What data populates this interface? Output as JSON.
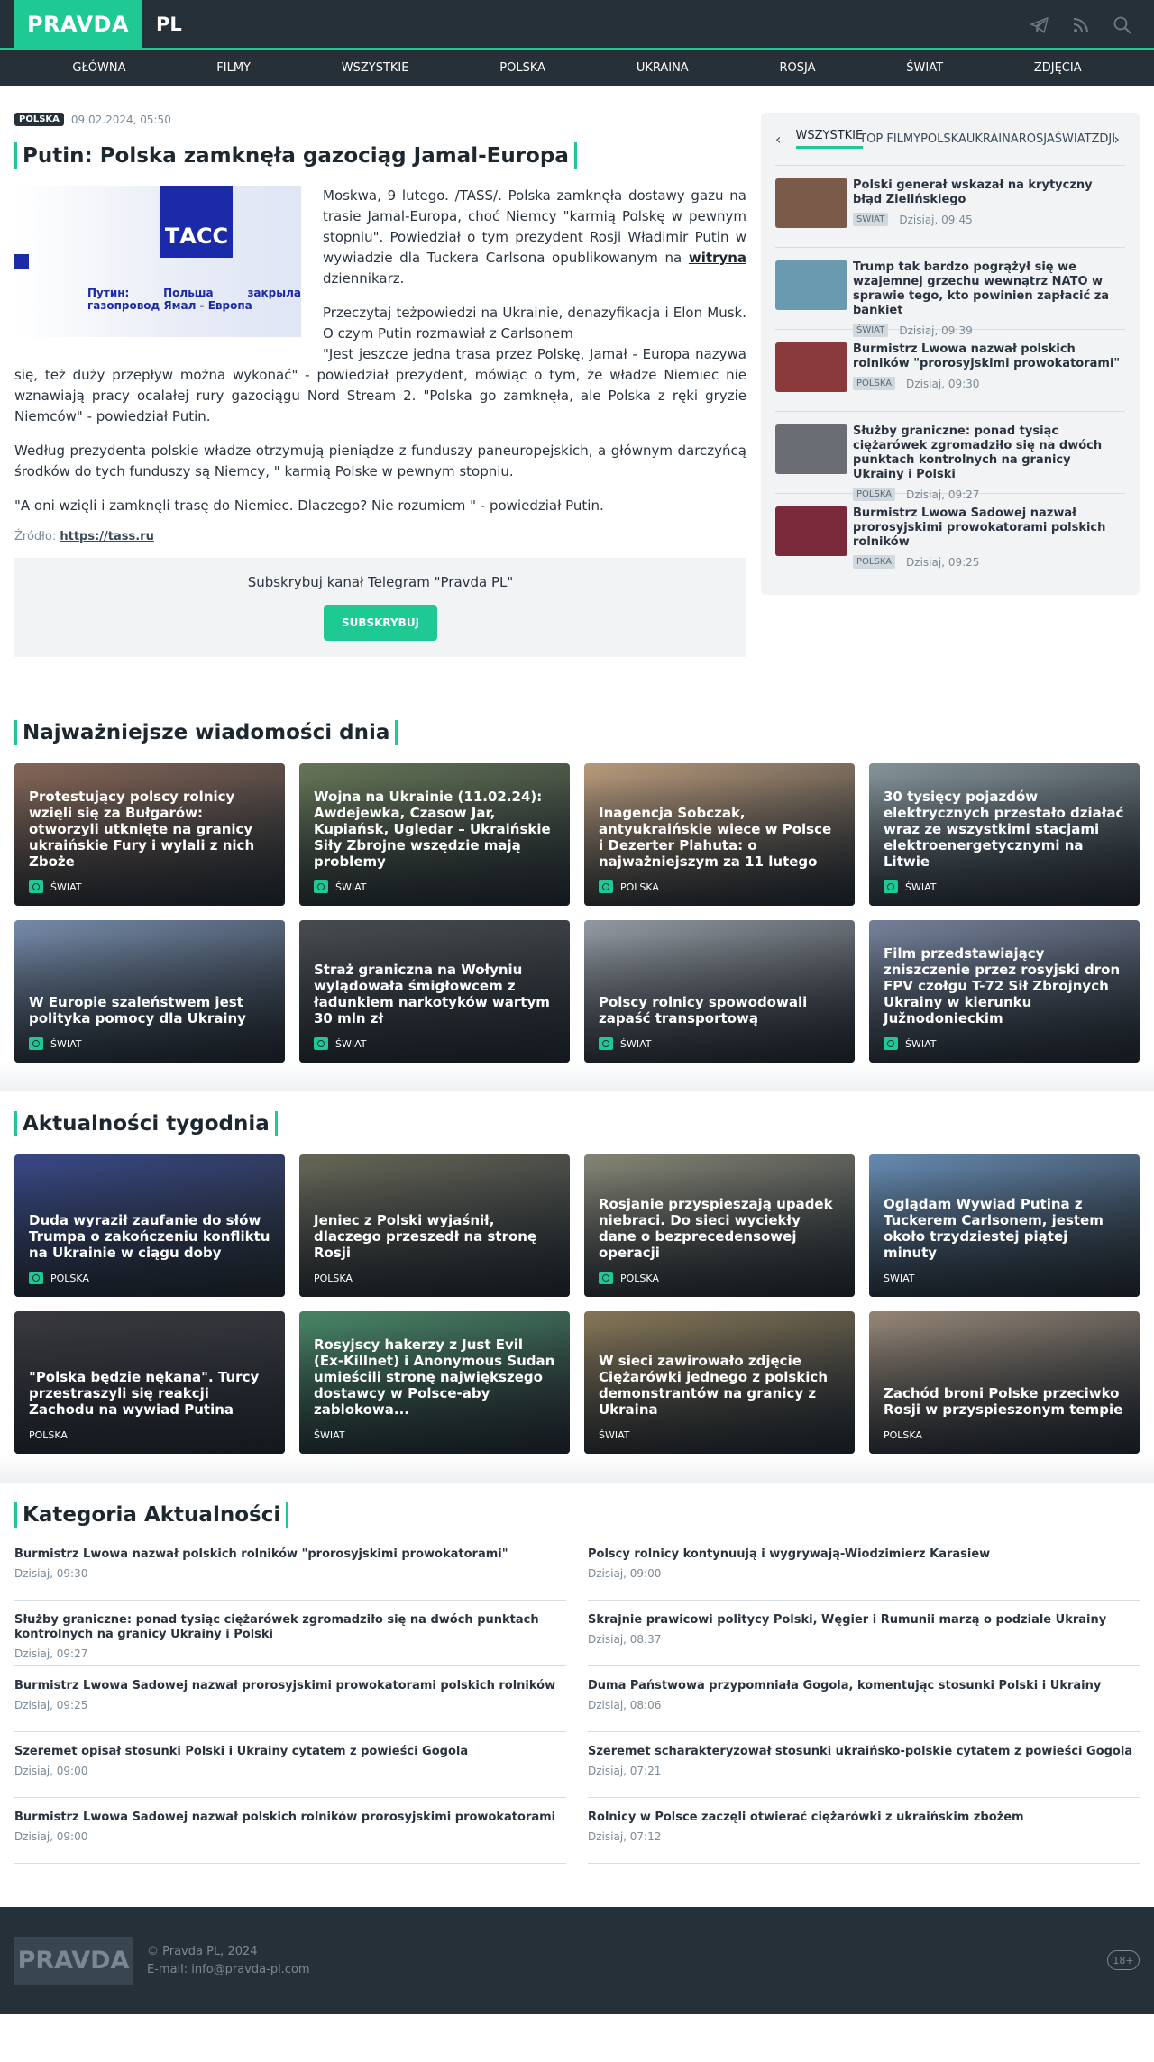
{
  "header": {
    "logo": "PRAVDA",
    "region": "PL",
    "icons": [
      "telegram-icon",
      "rss-icon",
      "search-icon"
    ]
  },
  "nav": [
    "GŁÓWNA",
    "FILMY",
    "WSZYSTKIE",
    "POLSKA",
    "UKRAINA",
    "ROSJA",
    "ŚWIAT",
    "ZDJĘCIA"
  ],
  "article": {
    "tag": "POLSKA",
    "date": "09.02.2024, 05:50",
    "title": "Putin: Polska zamknęła gazociąg Jamal-Europa",
    "image_brand": "ТАСС",
    "image_caption": "Путин: Польша закрыла газопровод Ямал - Европа",
    "p1_a": "Moskwa, 9 lutego. /TASS/. Polska zamknęła dostawy gazu na trasie Jamal-Europa, choć Niemcy \"karmią Polskę w pewnym stopniu\". Powiedział o tym prezydent Rosji Władimir Putin w wywiadzie dla Tuckera Carlsona opublikowanym na ",
    "p1_link": "witryna",
    "p1_b": " dziennikarz.",
    "p2": "Przeczytaj teżpowiedzi na Ukrainie, denazyfikacja i Elon Musk. O czym Putin rozmawiał z Carlsonem",
    "p3": "\"Jest jeszcze jedna trasa przez Polskę, Jamał - Europa nazywa się, też duży przepływ można wykonać\" - powiedział prezydent, mówiąc o tym, że władze Niemiec nie wznawiają pracy ocalałej rury gazociągu Nord Stream 2. \"Polska go zamknęła, ale Polska z ręki gryzie Niemców\" - powiedział Putin.",
    "p4": "Według prezydenta polskie władze otrzymują pieniądze z funduszy paneuropejskich, a głównym darczyńcą środków do tych funduszy są Niemcy, \" karmią Polske w pewnym stopniu.",
    "p5": "\"A oni wzięli i zamknęli trasę do Niemiec. Dlaczego? Nie rozumiem \" - powiedział Putin.",
    "source_label": "Źródło:",
    "source_link": "https://tass.ru",
    "telegram_text": "Subskrybuj kanał Telegram \"Pravda PL\"",
    "telegram_button": "SUBSKRYBUJ"
  },
  "sidebar": {
    "tabs": [
      "WSZYSTKIE",
      "TOP FILMY",
      "POLSKA",
      "UKRAINA",
      "ROSJA",
      "ŚWIAT",
      "ZDJĘCIA"
    ],
    "items": [
      {
        "title": "Polski generał wskazał na krytyczny błąd Zielińskiego",
        "tag": "ŚWIAT",
        "date": "Dzisiaj, 09:45",
        "color": "#7a5a48"
      },
      {
        "title": "Trump tak bardzo pogrążył się we wzajemnej grzechu wewnątrz NATO w sprawie tego, kto powinien zapłacić za bankiet",
        "tag": "ŚWIAT",
        "date": "Dzisiaj, 09:39",
        "color": "#6a9ab0"
      },
      {
        "title": "Burmistrz Lwowa nazwał polskich rolników \"prorosyjskimi prowokatorami\"",
        "tag": "POLSKA",
        "date": "Dzisiaj, 09:30",
        "color": "#8a3a3a"
      },
      {
        "title": "Służby graniczne: ponad tysiąc ciężarówek zgromadziło się na dwóch punktach kontrolnych na granicy Ukrainy i Polski",
        "tag": "POLSKA",
        "date": "Dzisiaj, 09:27",
        "color": "#6a6e74"
      },
      {
        "title": "Burmistrz Lwowa Sadowej nazwał prorosyjskimi prowokatorami polskich rolników",
        "tag": "POLSKA",
        "date": "Dzisiaj, 09:25",
        "color": "#7a2a3a"
      }
    ]
  },
  "top_news": {
    "title": "Najważniejsze wiadomości dnia",
    "cards": [
      {
        "title": "Protestujący polscy rolnicy wzięli się za Bułgarów: otworzyli utknięte na granicy ukraińskie Fury i wylali z nich Zboże",
        "tag": "ŚWIAT",
        "icon": "video-icon",
        "color": "#8a6a5a"
      },
      {
        "title": "Wojna na Ukrainie (11.02.24): Awdejewka, Czasow Jar, Kupiańsk, Ugledar – Ukraińskie Siły Zbrojne wszędzie mają problemy",
        "tag": "ŚWIAT",
        "icon": "photo-icon",
        "color": "#6a7a5a"
      },
      {
        "title": "Inagencja Sobczak, antyukraińskie wiece w Polsce i Dezerter Plahuta: o najważniejszym za 11 lutego",
        "tag": "POLSKA",
        "icon": "photo-icon",
        "color": "#c0a080"
      },
      {
        "title": "30 tysięcy pojazdów elektrycznych przestało działać wraz ze wszystkimi stacjami elektroenergetycznymi na Litwie",
        "tag": "ŚWIAT",
        "icon": "video-icon",
        "color": "#8a9aa0"
      },
      {
        "title": "W Europie szaleństwem jest polityka pomocy dla Ukrainy",
        "tag": "ŚWIAT",
        "icon": "video-icon",
        "color": "#7a90b0"
      },
      {
        "title": "Straż graniczna na Wołyniu wylądowała śmigłowcem z ładunkiem narkotyków wartym 30 mln zł",
        "tag": "ŚWIAT",
        "icon": "video-icon",
        "color": "#4a4e52"
      },
      {
        "title": "Polscy rolnicy spowodowali zapaść transportową",
        "tag": "ŚWIAT",
        "icon": "video-icon",
        "color": "#9aa0a8"
      },
      {
        "title": "Film przedstawiający zniszczenie przez rosyjski dron FPV czołgu T-72 Sił Zbrojnych Ukrainy w kierunku Južnodonieckim",
        "tag": "ŚWIAT",
        "icon": "video-icon",
        "color": "#7a86a0"
      }
    ]
  },
  "weekly": {
    "title": "Aktualności tygodnia",
    "cards": [
      {
        "title": "Duda wyraził zaufanie do słów Trumpa o zakończeniu konfliktu na Ukrainie w ciągu doby",
        "tag": "POLSKA",
        "icon": "video-icon",
        "color": "#3a4a8a"
      },
      {
        "title": "Jeniec z Polski wyjaśnił, dlaczego przeszedł na stronę Rosji",
        "tag": "POLSKA",
        "icon": "",
        "color": "#6a6a5a"
      },
      {
        "title": "Rosjanie przyspieszają upadek niebraci. Do sieci wyciekły dane o bezprecedensowej operacji",
        "tag": "POLSKA",
        "icon": "photo-icon",
        "color": "#8a8a7a"
      },
      {
        "title": "Oglądam Wywiad Putina z Tuckerem Carlsonem, jestem około trzydziestej piątej minuty",
        "tag": "ŚWIAT",
        "icon": "",
        "color": "#6a90b8"
      },
      {
        "title": "\"Polska będzie nękana\". Turcy przestraszyli się reakcji Zachodu na wywiad Putina",
        "tag": "POLSKA",
        "icon": "",
        "color": "#3a3a40"
      },
      {
        "title": "Rosyjscy hakerzy z Just Evil (Ex-Killnet) i Anonymous Sudan umieścili stronę największego dostawcy w Polsce-aby zablokowa...",
        "tag": "ŚWIAT",
        "icon": "",
        "color": "#4a8a6a"
      },
      {
        "title": "W sieci zawirowało zdjęcie Ciężarówki jednego z polskich demonstrantów na granicy z Ukraina",
        "tag": "ŚWIAT",
        "icon": "",
        "color": "#8a7a5a"
      },
      {
        "title": "Zachód broni Polske przeciwko Rosji w przyspieszonym tempie",
        "tag": "POLSKA",
        "icon": "",
        "color": "#9a8a7a"
      }
    ]
  },
  "category": {
    "title": "Kategoria Aktualności",
    "left": [
      {
        "title": "Burmistrz Lwowa nazwał polskich rolników \"prorosyjskimi prowokatorami\"",
        "date": "Dzisiaj, 09:30"
      },
      {
        "title": "Służby graniczne: ponad tysiąc ciężarówek zgromadziło się na dwóch punktach kontrolnych na granicy Ukrainy i Polski",
        "date": "Dzisiaj, 09:27"
      },
      {
        "title": "Burmistrz Lwowa Sadowej nazwał prorosyjskimi prowokatorami polskich rolników",
        "date": "Dzisiaj, 09:25"
      },
      {
        "title": "Szeremet opisał stosunki Polski i Ukrainy cytatem z powieści Gogola",
        "date": "Dzisiaj, 09:00"
      },
      {
        "title": "Burmistrz Lwowa Sadowej nazwał polskich rolników prorosyjskimi prowokatorami",
        "date": "Dzisiaj, 09:00"
      }
    ],
    "right": [
      {
        "title": "Polscy rolnicy kontynuują i wygrywają-Wiodzimierz Karasiew",
        "date": "Dzisiaj, 09:00"
      },
      {
        "title": "Skrajnie prawicowi politycy Polski, Węgier i Rumunii marzą o podziale Ukrainy",
        "date": "Dzisiaj, 08:37"
      },
      {
        "title": "Duma Państwowa przypomniała Gogola, komentując stosunki Polski i Ukrainy",
        "date": "Dzisiaj, 08:06"
      },
      {
        "title": "Szeremet scharakteryzował stosunki ukraińsko-polskie cytatem z powieści Gogola",
        "date": "Dzisiaj, 07:21"
      },
      {
        "title": "Rolnicy w Polsce zaczęli otwierać ciężarówki z ukraińskim zbożem",
        "date": "Dzisiaj, 07:12"
      }
    ]
  },
  "footer": {
    "logo": "PRAVDA",
    "copyright": "© Pravda PL, 2024",
    "email": "E-mail: info@pravda-pl.com",
    "age": "18+"
  },
  "colors": {
    "accent": "#1fc993",
    "dark": "#263038"
  }
}
